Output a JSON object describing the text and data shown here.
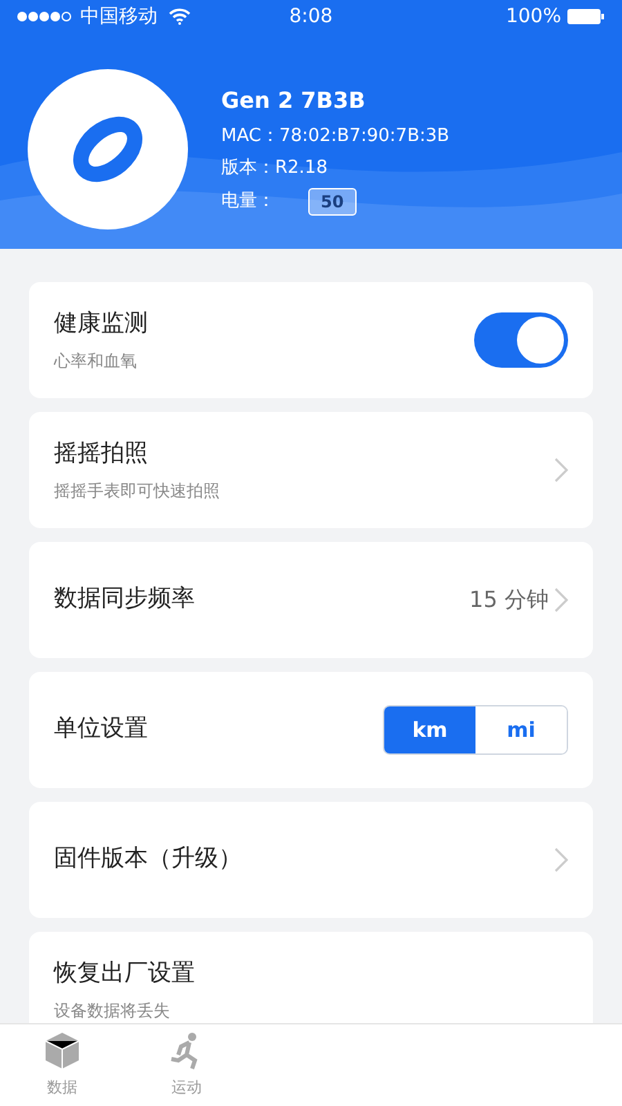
{
  "status_bar": {
    "carrier": "中国移动",
    "time": "8:08",
    "battery": "100%"
  },
  "device": {
    "name": "Gen 2 7B3B",
    "mac": "MAC：78:02:B7:90:7B:3B",
    "version": "版本：R2.18",
    "battery_label": "电量：",
    "battery_value": "50"
  },
  "settings": [
    {
      "kind": "toggle",
      "title": "健康监测",
      "subtitle": "心率和血氧",
      "on": true
    },
    {
      "kind": "link",
      "title": "摇摇拍照",
      "subtitle": "摇摇手表即可快速拍照"
    },
    {
      "kind": "link",
      "title": "数据同步频率",
      "value": "15 分钟"
    },
    {
      "kind": "segment",
      "title": "单位设置",
      "options": [
        {
          "label": "km",
          "selected": true
        },
        {
          "label": "mi",
          "selected": false
        }
      ]
    },
    {
      "kind": "link",
      "title": "固件版本（升级）"
    },
    {
      "kind": "plain",
      "title": "恢复出厂设置",
      "subtitle": "设备数据将丢失"
    }
  ],
  "tab_bar": [
    {
      "label": "数据"
    },
    {
      "label": "运动"
    }
  ]
}
